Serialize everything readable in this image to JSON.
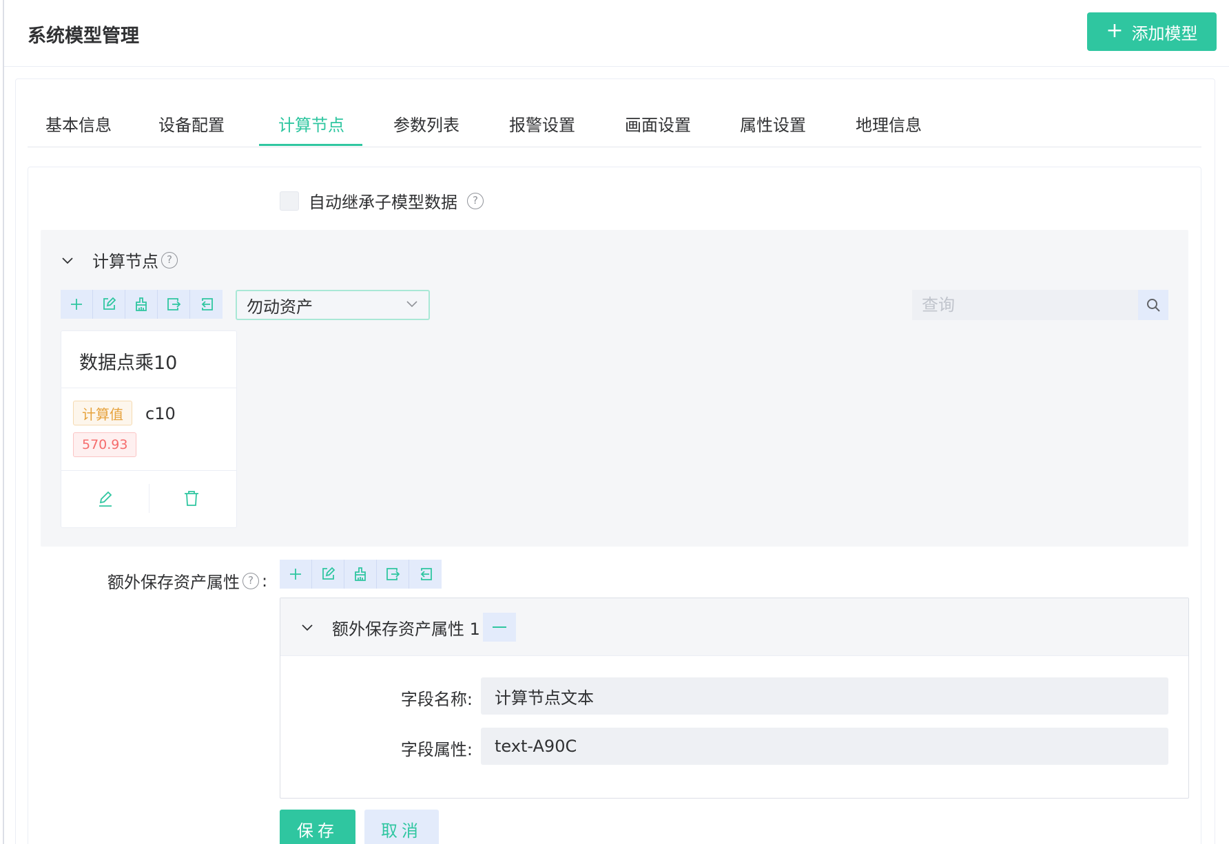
{
  "header": {
    "title": "系统模型管理",
    "add_button_label": "添加模型"
  },
  "tabs": [
    {
      "label": "基本信息",
      "active": false
    },
    {
      "label": "设备配置",
      "active": false
    },
    {
      "label": "计算节点",
      "active": true
    },
    {
      "label": "参数列表",
      "active": false
    },
    {
      "label": "报警设置",
      "active": false
    },
    {
      "label": "画面设置",
      "active": false
    },
    {
      "label": "属性设置",
      "active": false
    },
    {
      "label": "地理信息",
      "active": false
    }
  ],
  "inherit": {
    "label": "自动继承子模型数据",
    "checked": false
  },
  "calc_nodes": {
    "title": "计算节点",
    "selected_asset": "勿动资产",
    "search_placeholder": "查询",
    "card": {
      "title": "数据点乘10",
      "type_tag": "计算值",
      "code": "c10",
      "value": "570.93"
    }
  },
  "extra": {
    "label": "额外保存资产属性",
    "colon": ":",
    "item_title": "额外保存资产属性 1",
    "field_name_label": "字段名称:",
    "field_name_value": "计算节点文本",
    "field_attr_label": "字段属性:",
    "field_attr_value": "text-A90C"
  },
  "actions": {
    "save_label": "保存",
    "cancel_label": "取消"
  },
  "icons": {
    "help": "?",
    "chevron": "chevron-down-icon"
  },
  "colors": {
    "primary": "#2fc6a0",
    "tool_bg": "#e3ebfb",
    "warning": "#e6a23c",
    "danger": "#f56c6c"
  }
}
